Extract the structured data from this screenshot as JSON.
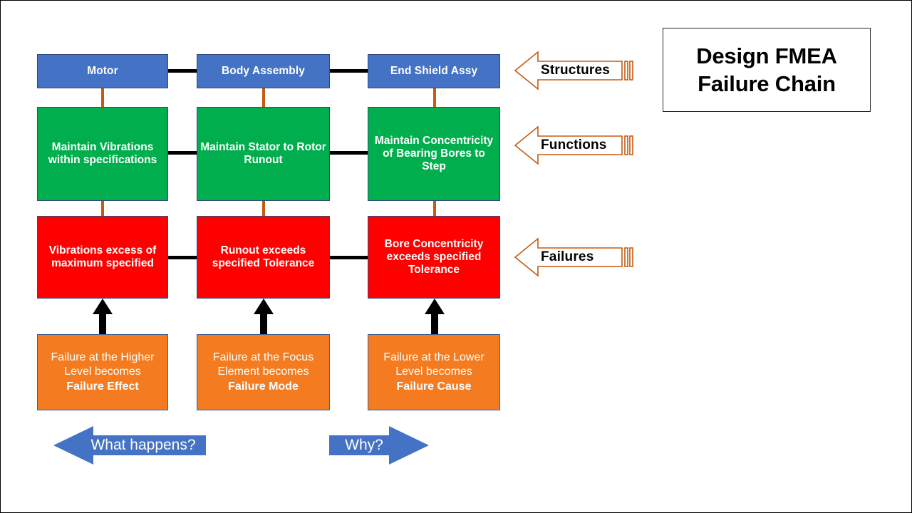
{
  "title": {
    "line1": "Design FMEA",
    "line2": "Failure Chain"
  },
  "colors": {
    "structure": "#4472C4",
    "function": "#00AE4D",
    "failure": "#FF0000",
    "definition": "#F47B20",
    "connector_vertical": "#C55A11",
    "connector_horizontal": "#000000",
    "band_arrow_outline": "#C55A11",
    "flow_arrow": "#4472C4",
    "page_border": "#000000"
  },
  "rows": {
    "structures": {
      "band_label": "Structures",
      "items": [
        {
          "label": "Motor"
        },
        {
          "label": "Body Assembly"
        },
        {
          "label": "End Shield Assy"
        }
      ]
    },
    "functions": {
      "band_label": "Functions",
      "items": [
        {
          "label": "Maintain Vibrations  within specifications"
        },
        {
          "label": "Maintain  Stator to Rotor Runout"
        },
        {
          "label": "Maintain Concentricity of Bearing Bores to Step"
        }
      ]
    },
    "failures": {
      "band_label": "Failures",
      "items": [
        {
          "label": "Vibrations  excess of maximum specified"
        },
        {
          "label": "Runout exceeds specified Tolerance"
        },
        {
          "label": "Bore Concentricity exceeds specified Tolerance"
        }
      ]
    },
    "definitions": {
      "items": [
        {
          "lead": "Failure at the Higher Level becomes",
          "term": "Failure Effect"
        },
        {
          "lead": "Failure at the Focus Element becomes",
          "term": "Failure Mode"
        },
        {
          "lead": "Failure at the Lower Level becomes",
          "term": "Failure Cause"
        }
      ]
    }
  },
  "flow": {
    "left": {
      "label": "What happens?",
      "direction": "left"
    },
    "right": {
      "label": "Why?",
      "direction": "right"
    }
  }
}
